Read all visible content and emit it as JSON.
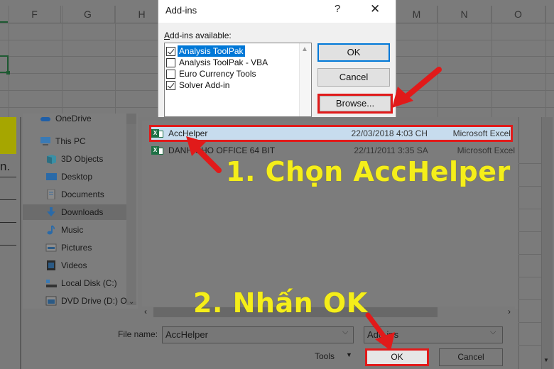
{
  "spreadsheet": {
    "column_headers": [
      "F",
      "G",
      "H",
      "M",
      "N",
      "O"
    ],
    "partial_cell_text": "n."
  },
  "addins_dialog": {
    "title": "Add-ins",
    "help_icon": "?",
    "close_icon": "✕",
    "list_label_prefix": "A",
    "list_label_rest": "dd-ins available:",
    "items": [
      {
        "label": "Analysis ToolPak",
        "checked": true,
        "selected": true
      },
      {
        "label": "Analysis ToolPak - VBA",
        "checked": false,
        "selected": false
      },
      {
        "label": "Euro Currency Tools",
        "checked": false,
        "selected": false
      },
      {
        "label": "Solver Add-in",
        "checked": true,
        "selected": false
      }
    ],
    "buttons": {
      "ok": "OK",
      "cancel": "Cancel",
      "browse": "Browse..."
    }
  },
  "browse_dialog": {
    "nav_items": [
      {
        "label": "OneDrive",
        "icon": "cloud-icon"
      },
      {
        "label": "This PC",
        "icon": "computer-icon"
      },
      {
        "label": "3D Objects",
        "icon": "cube-icon"
      },
      {
        "label": "Desktop",
        "icon": "desktop-icon"
      },
      {
        "label": "Documents",
        "icon": "document-icon"
      },
      {
        "label": "Downloads",
        "icon": "download-icon",
        "active": true
      },
      {
        "label": "Music",
        "icon": "music-icon"
      },
      {
        "label": "Pictures",
        "icon": "pictures-icon"
      },
      {
        "label": "Videos",
        "icon": "videos-icon"
      },
      {
        "label": "Local Disk (C:)",
        "icon": "disk-icon"
      },
      {
        "label": "DVD Drive (D:) O",
        "icon": "dvd-icon"
      }
    ],
    "files": [
      {
        "name": "AccHelper",
        "date": "22/03/2018 4:03 CH",
        "type": "Microsoft Excel",
        "selected": true
      },
      {
        "name": "DANH CHO OFFICE 64 BIT",
        "date": "22/11/2011 3:35 SA",
        "type": "Microsoft Excel",
        "selected": false
      }
    ],
    "file_name_label": "File name:",
    "file_name_value": "AccHelper",
    "file_type_value": "Add-ins",
    "tools_label": "Tools",
    "ok_label": "OK",
    "cancel_label": "Cancel"
  },
  "annotations": {
    "step1": "1. Chọn AccHelper",
    "step2": "2. Nhấn OK",
    "color": "#f5ee1a",
    "arrow_color": "#e11a1a"
  }
}
